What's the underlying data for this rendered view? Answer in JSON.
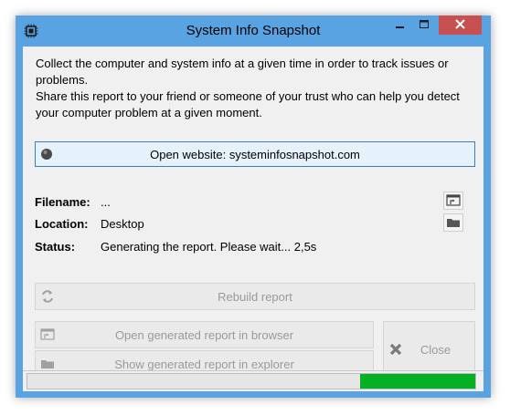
{
  "window": {
    "title": "System Info Snapshot",
    "icon": "chip-icon"
  },
  "description": {
    "line1": "Collect the computer and system info at a given time in order to track issues or problems.",
    "line2": "Share this report to your friend or someone of your trust who can help you detect your computer problem at a given moment."
  },
  "website_button": {
    "label": "Open website: systeminfosnapshot.com",
    "icon": "globe-icon"
  },
  "fields": {
    "filename": {
      "label": "Filename:",
      "value": "..."
    },
    "location": {
      "label": "Location:",
      "value": "Desktop"
    },
    "status": {
      "label": "Status:",
      "value": "Generating the report. Please wait... 2,5s"
    }
  },
  "buttons": {
    "rebuild": "Rebuild report",
    "open_browser": "Open generated report in browser",
    "show_explorer": "Show generated report in explorer",
    "close": "Close"
  },
  "progress": {
    "position": "right",
    "color": "#06b025"
  },
  "colors": {
    "title_bar": "#5aa3e3",
    "close_button": "#c75050",
    "progress": "#06b025"
  }
}
